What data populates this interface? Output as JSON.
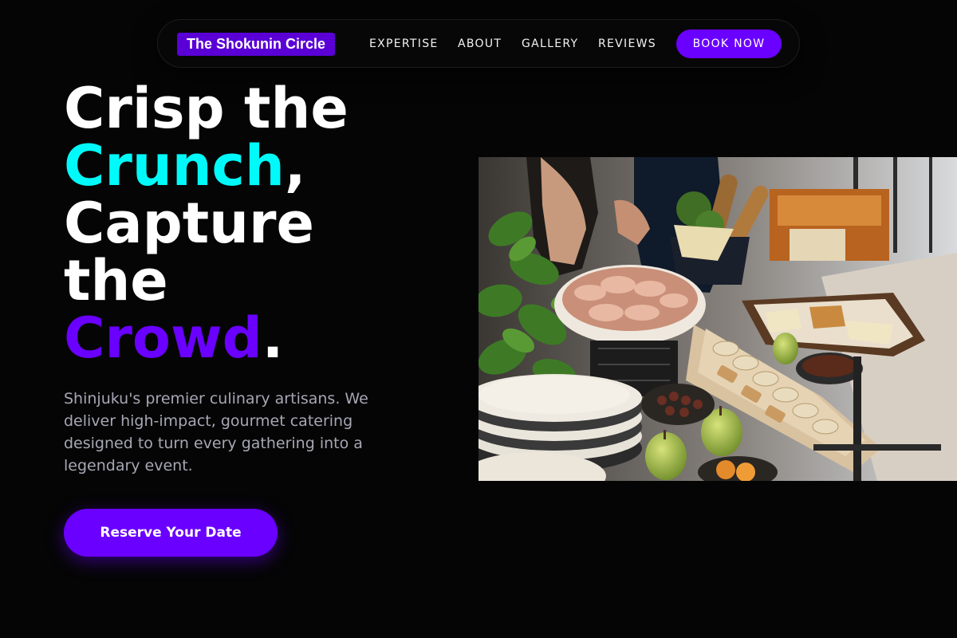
{
  "nav": {
    "brand": "The Shokunin Circle",
    "links": [
      "EXPERTISE",
      "ABOUT",
      "GALLERY",
      "REVIEWS"
    ],
    "cta": "BOOK NOW"
  },
  "hero": {
    "headline": {
      "line1": "Crisp the",
      "line2_accent": "Crunch",
      "line2_punct": ",",
      "line3": "Capture",
      "line4": "the",
      "line5_accent": "Crowd",
      "line5_punct": "."
    },
    "subtitle": "Shinjuku's premier culinary artisans. We deliver high-impact, gourmet catering designed to turn every gathering into a legendary event.",
    "cta": "Reserve Your Date",
    "image_subject": "gourmet catering grazing table with charcuterie, breads, cheeses and pears"
  },
  "colors": {
    "background": "#050505",
    "accent_purple": "#6a00ff",
    "accent_cyan": "#00fafa",
    "brand_bg": "#5a00d6",
    "subtitle_text": "#a7a7b5"
  }
}
